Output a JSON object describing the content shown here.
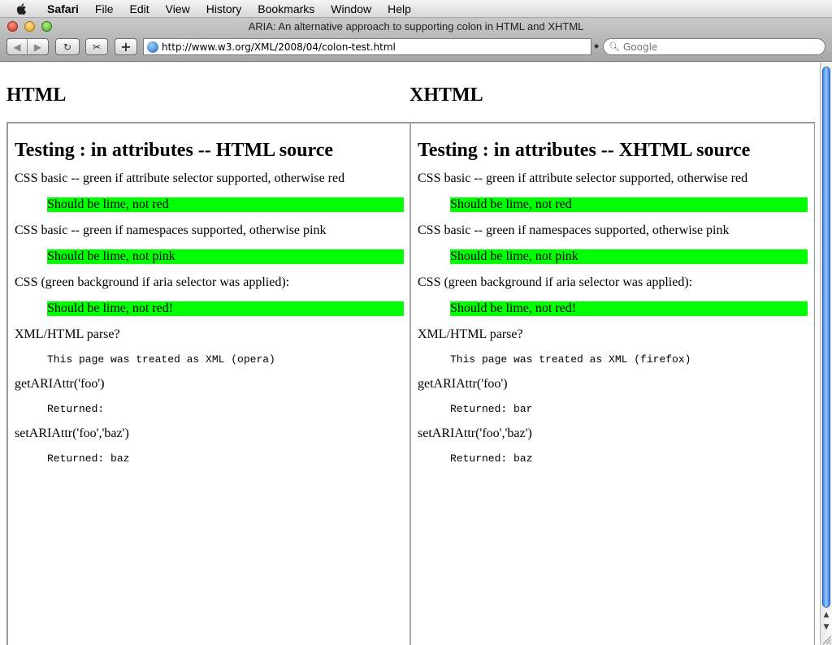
{
  "menubar": {
    "app": "Safari",
    "items": [
      "File",
      "Edit",
      "View",
      "History",
      "Bookmarks",
      "Window",
      "Help"
    ]
  },
  "window": {
    "title": "ARIA: An alternative approach to supporting colon in HTML and XHTML"
  },
  "toolbar": {
    "back_icon": "◀",
    "forward_icon": "▶",
    "reload_icon": "↻",
    "snip_icon": "✂",
    "add_icon": "+",
    "url": "http://www.w3.org/XML/2008/04/colon-test.html",
    "search_placeholder": "Google"
  },
  "page": {
    "left_heading": "HTML",
    "right_heading": "XHTML",
    "frames": [
      {
        "title": "Testing : in attributes -- HTML source",
        "css_attr_label": "CSS basic -- green if attribute selector supported, otherwise red",
        "css_attr_result": "Should be lime, not red",
        "css_ns_label": "CSS basic -- green if namespaces supported, otherwise pink",
        "css_ns_result": "Should be lime, not pink",
        "css_aria_label": "CSS (green background if aria selector was applied):",
        "css_aria_result": "Should be lime, not red!",
        "parse_label": "XML/HTML parse?",
        "parse_result": "This page was treated as XML (opera)",
        "get_label": "getARIAttr('foo')",
        "get_result": "Returned:",
        "set_label": "setARIAttr('foo','baz')",
        "set_result": "Returned: baz"
      },
      {
        "title": "Testing : in attributes -- XHTML source",
        "css_attr_label": "CSS basic -- green if attribute selector supported, otherwise red",
        "css_attr_result": "Should be lime, not red",
        "css_ns_label": "CSS basic -- green if namespaces supported, otherwise pink",
        "css_ns_result": "Should be lime, not pink",
        "css_aria_label": "CSS (green background if aria selector was applied):",
        "css_aria_result": "Should be lime, not red!",
        "parse_label": "XML/HTML parse?",
        "parse_result": "This page was treated as XML (firefox)",
        "get_label": "getARIAttr('foo')",
        "get_result": "Returned: bar",
        "set_label": "setARIAttr('foo','baz')",
        "set_result": "Returned: baz"
      }
    ]
  },
  "colors": {
    "lime": "#00ff00",
    "scroll_thumb": "#3a7ee8"
  }
}
